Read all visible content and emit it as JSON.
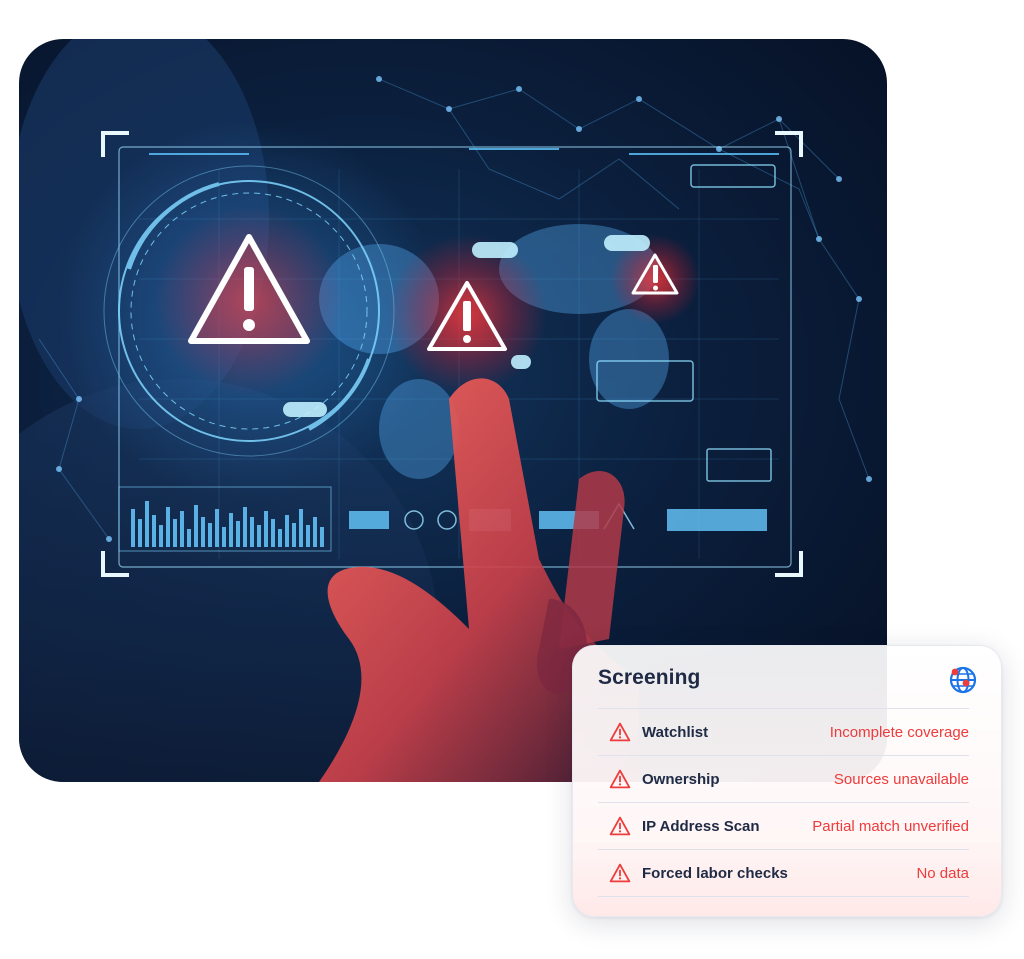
{
  "hero": {
    "icons": [
      "warning-triangle-icon",
      "world-map",
      "bar-graph"
    ]
  },
  "screening": {
    "title": "Screening",
    "header_icon": "globe-icon",
    "accent_color": "#ee3b3b",
    "rows": [
      {
        "label": "Watchlist",
        "status": "Incomplete coverage",
        "icon": "warning-icon"
      },
      {
        "label": "Ownership",
        "status": "Sources unavailable",
        "icon": "warning-icon"
      },
      {
        "label": "IP Address Scan",
        "status": "Partial match unverified",
        "icon": "warning-icon"
      },
      {
        "label": "Forced labor checks",
        "status": "No data",
        "icon": "warning-icon"
      }
    ]
  }
}
